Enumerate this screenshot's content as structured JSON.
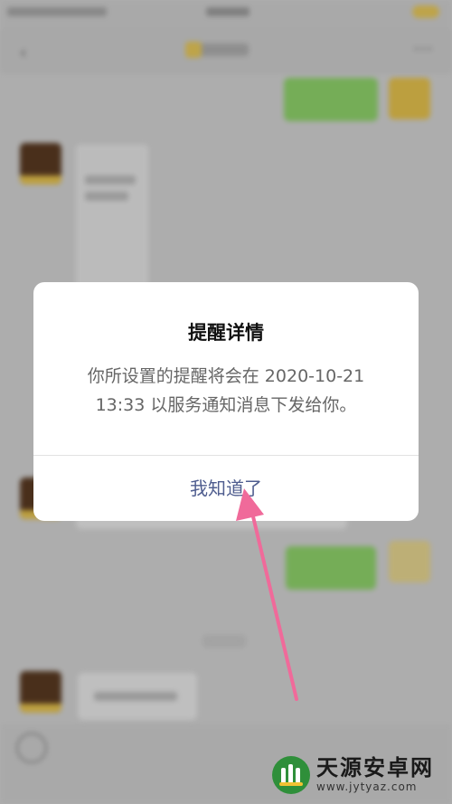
{
  "dialog": {
    "title": "提醒详情",
    "message_line1": "你所设置的提醒将会在 2020-10-21",
    "message_line2": "13:33 以服务通知消息下发给你。",
    "confirm_label": "我知道了"
  },
  "watermark": {
    "name": "天源安卓网",
    "url": "www.jytyaz.com"
  },
  "colors": {
    "button_text": "#4f5d8f",
    "arrow": "#f06a9a",
    "chat_bubble_green": "#8fd36b"
  },
  "icons": [
    "back-icon",
    "more-icon",
    "voice-icon",
    "pointer-arrow",
    "watermark-logo"
  ]
}
